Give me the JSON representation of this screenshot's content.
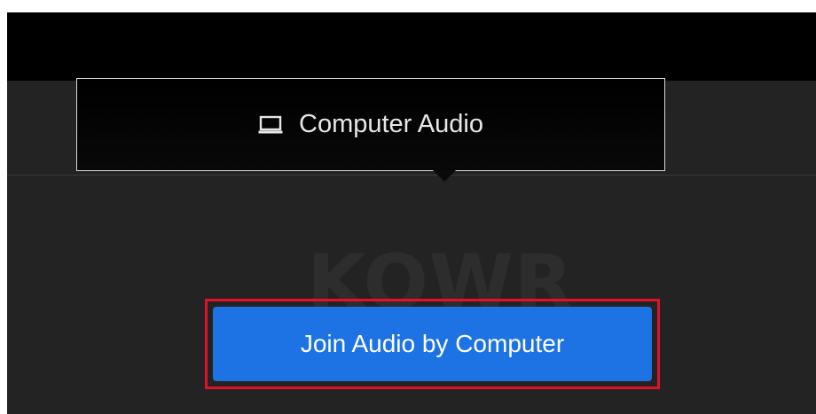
{
  "audio_tab": {
    "label": "Computer Audio",
    "icon": "computer-icon"
  },
  "watermark": {
    "text": "KOWR"
  },
  "join_button": {
    "label": "Join Audio by Computer",
    "color": "#1d73e4",
    "highlight_color": "#e0122a"
  }
}
